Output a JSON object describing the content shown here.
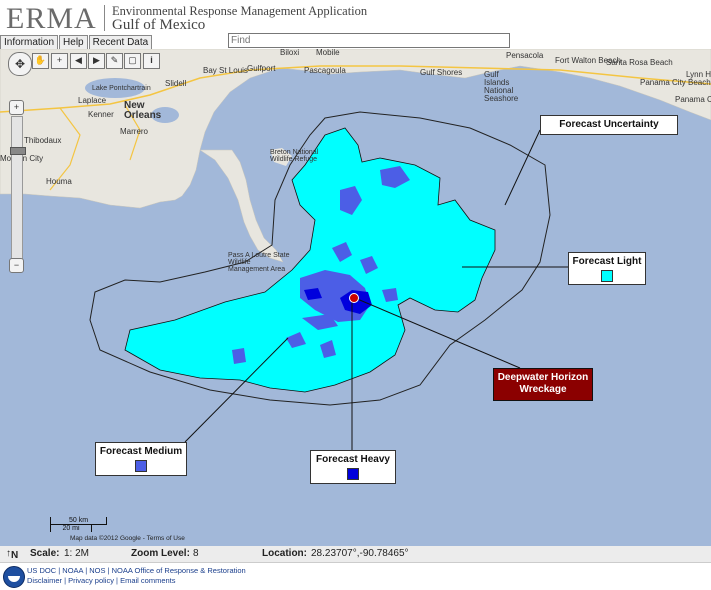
{
  "header": {
    "logo": "ERMA",
    "app_name": "Environmental Response Management Application",
    "region": "Gulf of Mexico"
  },
  "tabs": [
    "Information",
    "Help",
    "Recent Data"
  ],
  "search": {
    "placeholder": "Find",
    "value": ""
  },
  "map": {
    "water_color": "#a2b8d9",
    "land_color": "#e8e6df",
    "places": [
      "Bay St Louis",
      "Gulfport",
      "Pascagoula",
      "Biloxi",
      "Mobile",
      "Pensacola",
      "Fort Walton Beach",
      "Santa Rosa Beach",
      "Panama City Beach",
      "Panama City",
      "Lynn Hav",
      "Gulf Shores",
      "Gulf Islands National Seashore",
      "Slidell",
      "Laplace",
      "Kenner",
      "New Orleans",
      "Marrero",
      "Thibodaux",
      "Houma",
      "Morgan City",
      "Breton National Wildlife Refuge",
      "Pass A Loutre State Wildlife Management Area",
      "Lake Pontchartrain"
    ],
    "callouts": {
      "uncertainty": "Forecast Uncertainty",
      "light": "Forecast Light",
      "medium": "Forecast Medium",
      "heavy": "Forecast Heavy",
      "wreckage": "Deepwater Horizon Wreckage"
    },
    "colors": {
      "light": "#00ffff",
      "medium": "#4c5ee6",
      "heavy": "#0000dd",
      "wreckage": "#8b0000"
    },
    "scale": {
      "km": "50 km",
      "mi": "20 mi"
    },
    "attribution": "Map data ©2012 Google - Terms of Use",
    "icons": [
      "pan-icon",
      "zoom-in-icon",
      "zoom-out-icon",
      "info-icon",
      "measure-icon"
    ]
  },
  "status": {
    "north": "N",
    "scale_label": "Scale:",
    "scale_value": "1: 2M",
    "zoom_label": "Zoom Level:",
    "zoom_value": "8",
    "location_label": "Location:",
    "location_value": "28.23707°,-90.78465°"
  },
  "footer": {
    "line1": "US DOC | NOAA | NOS | NOAA Office of Response & Restoration",
    "line2": "Disclaimer | Privacy policy | Email comments"
  }
}
